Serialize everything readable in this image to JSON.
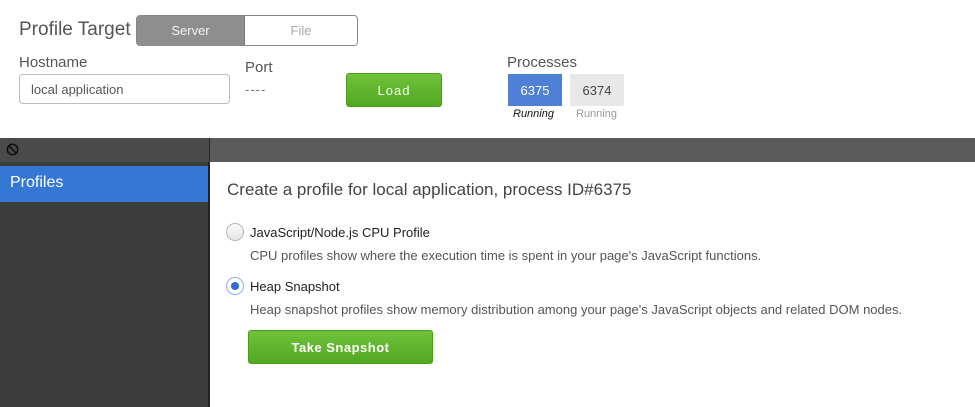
{
  "target": {
    "label": "Profile Target",
    "options": [
      "Server",
      "File"
    ],
    "selected": "Server"
  },
  "hostname": {
    "label": "Hostname",
    "value": "local application"
  },
  "port": {
    "label": "Port",
    "value": "----"
  },
  "load_label": "Load",
  "processes": {
    "label": "Processes",
    "items": [
      {
        "id": "6375",
        "status": "Running",
        "selected": true
      },
      {
        "id": "6374",
        "status": "Running",
        "selected": false
      }
    ]
  },
  "toolbar": {
    "clear_icon": "circle-slash-icon"
  },
  "sidebar": {
    "items": [
      {
        "label": "Profiles"
      }
    ]
  },
  "main": {
    "title": "Create a profile for local application, process ID#6375",
    "options": [
      {
        "label": "JavaScript/Node.js CPU Profile",
        "description": "CPU profiles show where the execution time is spent in your page's JavaScript functions.",
        "checked": false
      },
      {
        "label": "Heap Snapshot",
        "description": "Heap snapshot profiles show memory distribution among your page's JavaScript objects and related DOM nodes.",
        "checked": true
      }
    ],
    "action_label": "Take Snapshot"
  },
  "colors": {
    "accent_blue": "#3478d4",
    "process_selected": "#4e81d6",
    "button_green": "#5db42b",
    "sidebar_bg": "#3c3c3c"
  }
}
